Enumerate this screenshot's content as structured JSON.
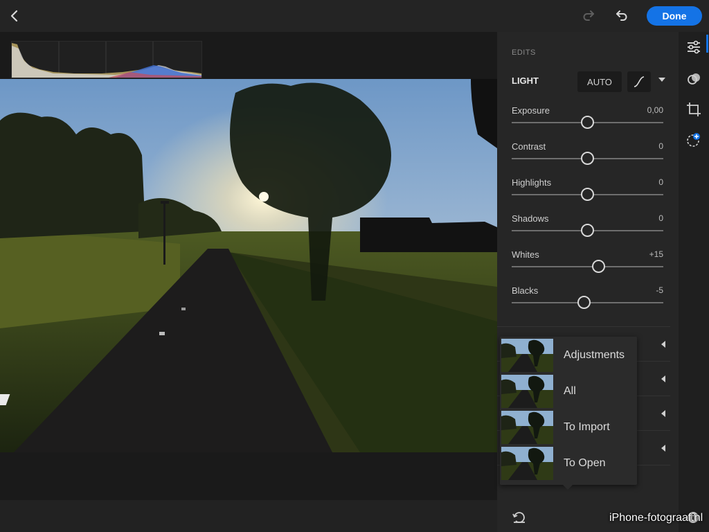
{
  "topbar": {
    "back_icon": "chevron-left-icon",
    "redo_icon": "redo-icon",
    "undo_icon": "undo-icon",
    "done_label": "Done",
    "accent": "#1473e6"
  },
  "histogram": {
    "icon": "histogram"
  },
  "panel": {
    "section_label": "EDITS",
    "light": {
      "title": "LIGHT",
      "auto_label": "AUTO",
      "curve_icon": "tone-curve-icon"
    },
    "sliders": [
      {
        "label": "Exposure",
        "value": "0,00",
        "position": 0.5
      },
      {
        "label": "Contrast",
        "value": "0",
        "position": 0.5
      },
      {
        "label": "Highlights",
        "value": "0",
        "position": 0.5
      },
      {
        "label": "Shadows",
        "value": "0",
        "position": 0.5
      },
      {
        "label": "Whites",
        "value": "+15",
        "position": 0.575
      },
      {
        "label": "Blacks",
        "value": "-5",
        "position": 0.475
      }
    ]
  },
  "popup": {
    "items": [
      {
        "label": "Adjustments"
      },
      {
        "label": "All"
      },
      {
        "label": "To Import"
      },
      {
        "label": "To Open"
      }
    ]
  },
  "rail": {
    "icons": [
      "edit-sliders-icon",
      "selective-mask-icon",
      "crop-icon",
      "healing-icon"
    ]
  },
  "bottom": {
    "reset_icon": "reset-icon",
    "info_icon": "info-icon"
  },
  "watermark": "iPhone-fotograaf.nl"
}
